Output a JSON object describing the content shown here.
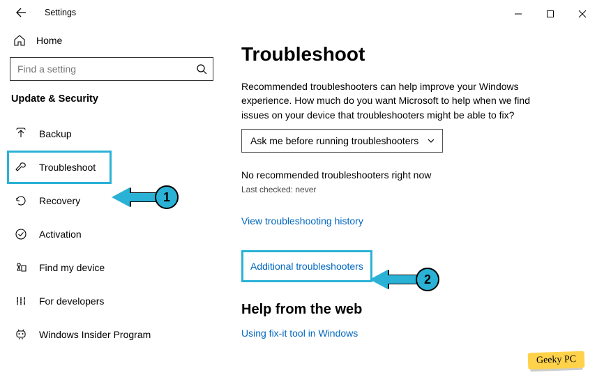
{
  "window": {
    "title": "Settings"
  },
  "sidebar": {
    "home": "Home",
    "search_placeholder": "Find a setting",
    "category": "Update & Security",
    "items": [
      {
        "label": "Backup"
      },
      {
        "label": "Troubleshoot"
      },
      {
        "label": "Recovery"
      },
      {
        "label": "Activation"
      },
      {
        "label": "Find my device"
      },
      {
        "label": "For developers"
      },
      {
        "label": "Windows Insider Program"
      }
    ]
  },
  "main": {
    "title": "Troubleshoot",
    "description": "Recommended troubleshooters can help improve your Windows experience. How much do you want Microsoft to help when we find issues on your device that troubleshooters might be able to fix?",
    "dropdown_value": "Ask me before running troubleshooters",
    "status": "No recommended troubleshooters right now",
    "last_checked": "Last checked: never",
    "link_history": "View troubleshooting history",
    "link_additional": "Additional troubleshooters",
    "help_heading": "Help from the web",
    "link_fixit": "Using fix-it tool in Windows"
  },
  "annotations": {
    "n1": "1",
    "n2": "2"
  },
  "watermark": "Geeky PC"
}
